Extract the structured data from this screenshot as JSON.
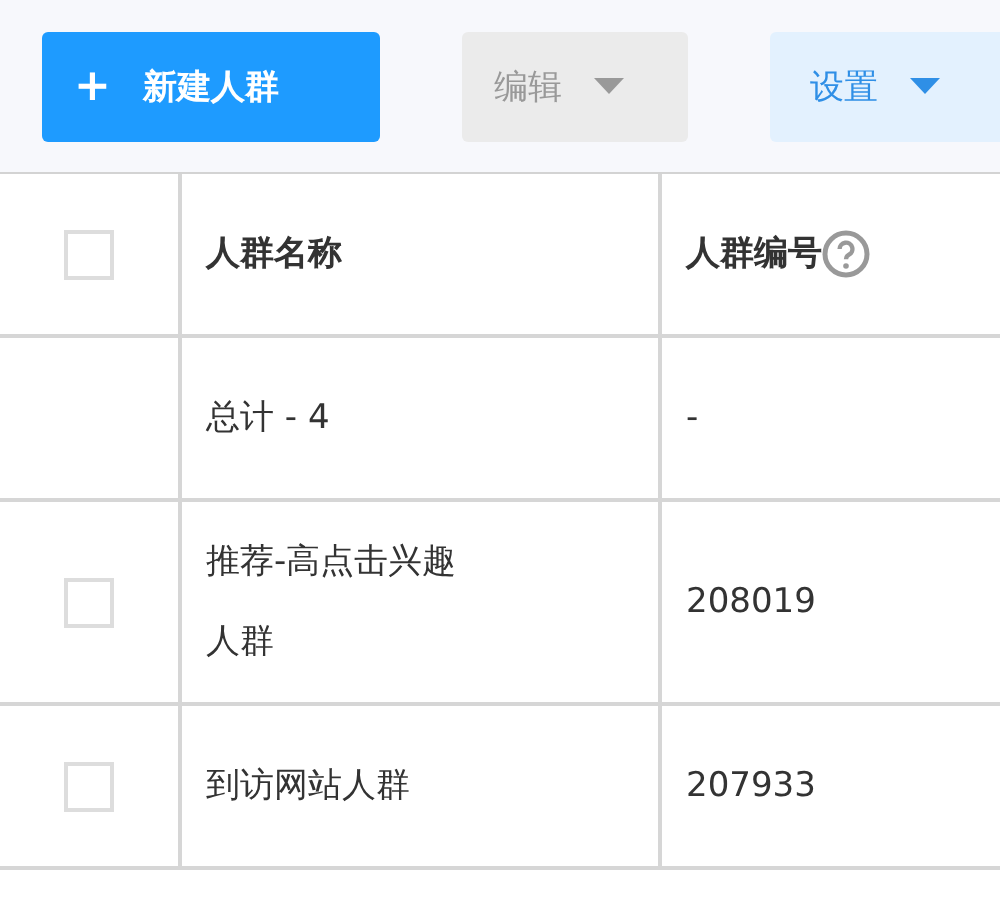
{
  "toolbar": [
    {
      "kind": "primary",
      "icon": "+",
      "label": "新建人群",
      "disabled": false,
      "dropdown": false
    },
    {
      "kind": "plain",
      "label": "编辑",
      "disabled": true,
      "dropdown": true
    },
    {
      "kind": "light",
      "label": "设置",
      "disabled": false,
      "dropdown": true
    }
  ],
  "table": {
    "header_checkbox": {
      "checked": false
    },
    "columns": [
      {
        "label": "人群名称",
        "help": false
      },
      {
        "label": "人群编号",
        "help": true
      }
    ],
    "rows": [
      {
        "kind": "total",
        "cells": [
          "总计 - 4",
          "-"
        ]
      },
      {
        "kind": "item",
        "checked": false,
        "cells": [
          "推荐-高点击兴趣人群",
          "208019"
        ]
      },
      {
        "kind": "item",
        "checked": false,
        "cells": [
          "到访网站人群",
          "207933"
        ]
      }
    ]
  }
}
